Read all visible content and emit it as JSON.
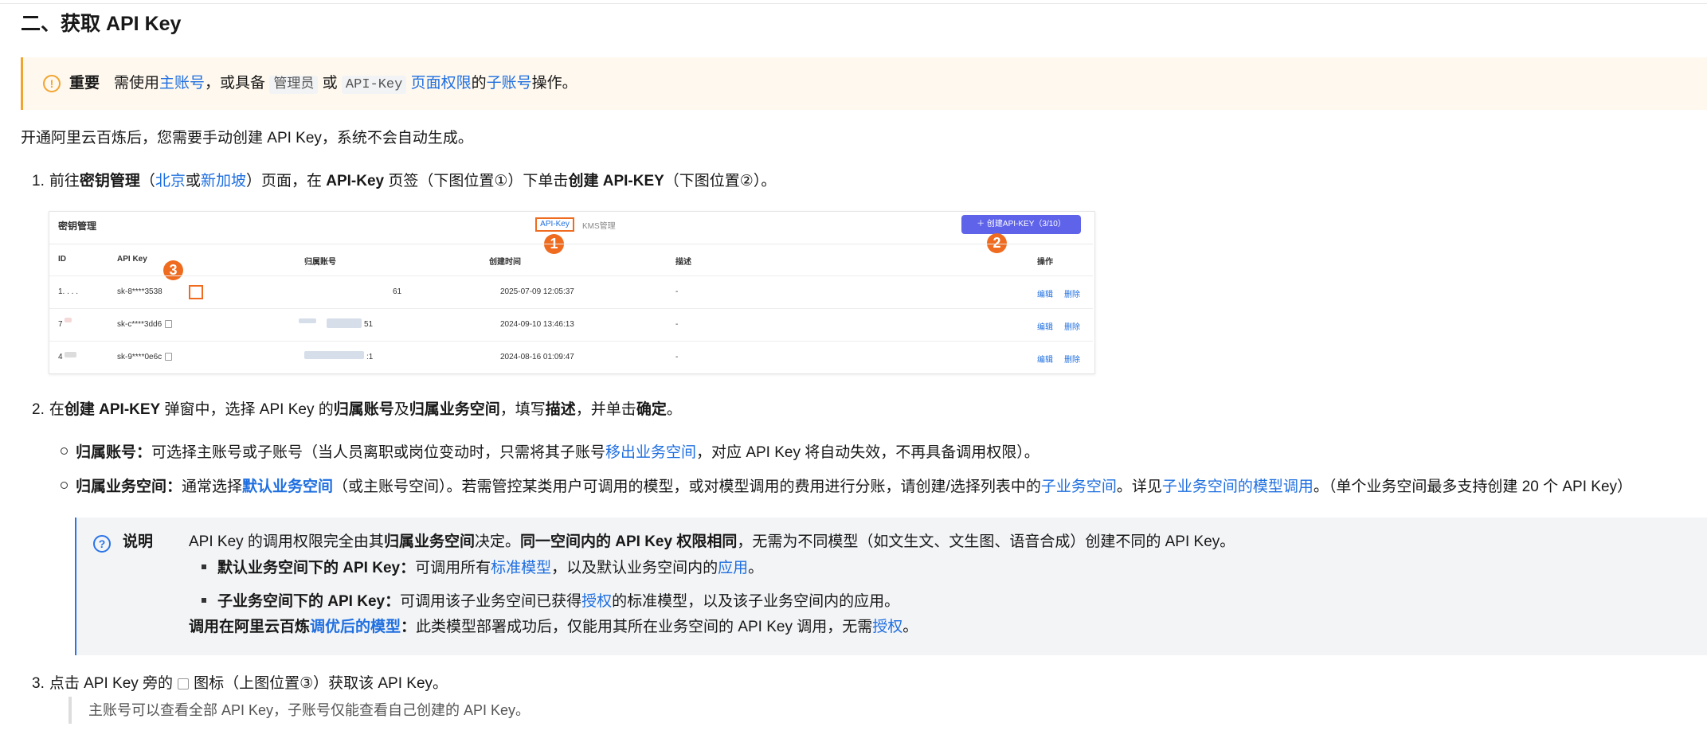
{
  "section_title": "二、获取 API Key",
  "notice": {
    "label": "重要",
    "t1": "需使用",
    "link1": "主账号",
    "t2": "，或具备",
    "code1": "管理员",
    "t3": "或",
    "code2": "API-Key",
    "link2": "页面权限",
    "t4": "的",
    "link3": "子账号",
    "t5": "操作。"
  },
  "intro": "开通阿里云百炼后，您需要手动创建 API Key，系统不会自动生成。",
  "step1": {
    "num": "1.",
    "t1": "前往",
    "b1": "密钥管理",
    "t2": "（",
    "link1": "北京",
    "t3": "或",
    "link2": "新加坡",
    "t4": "）页面，在",
    "b2": "API-Key",
    "t5": "页签（下图位置①）下单击",
    "b3": "创建 API-KEY",
    "t6": "（下图位置②）。"
  },
  "screenshot": {
    "title": "密钥管理",
    "tab_active": "API-Key",
    "tab_other": "KMS管理",
    "create_button": "＋ 创建API-KEY（3/10）",
    "badge1": "1",
    "badge2": "2",
    "badge3": "3",
    "headers": [
      "ID",
      "API Key",
      "归属账号",
      "创建时间",
      "描述",
      "操作"
    ],
    "rows": [
      {
        "id": "1. . . .",
        "key": "sk-8****3538",
        "account": "61",
        "created": "2025-07-09 12:05:37",
        "desc": "-",
        "edit": "编辑",
        "del": "删除"
      },
      {
        "id": "7",
        "key": "sk-c****3dd6",
        "account": "51",
        "created": "2024-09-10 13:46:13",
        "desc": "-",
        "edit": "编辑",
        "del": "删除"
      },
      {
        "id": "4",
        "key": "sk-9****0e6c",
        "account": ":1",
        "created": "2024-08-16 01:09:47",
        "desc": "-",
        "edit": "编辑",
        "del": "删除"
      }
    ]
  },
  "step2": {
    "num": "2.",
    "t1": "在",
    "b1": "创建 API-KEY",
    "t2": "弹窗中，选择 API Key 的",
    "b2": "归属账号",
    "t3": "及",
    "b3": "归属业务空间",
    "t4": "，填写",
    "b4": "描述",
    "t5": "，并单击",
    "b5": "确定",
    "t6": "。"
  },
  "bullet1": {
    "b1": "归属账号：",
    "t1": "可选择主账号或子账号（当人员离职或岗位变动时，只需将其子账号",
    "link1": "移出业务空间",
    "t2": "，对应 API Key 将自动失效，不再具备调用权限）。"
  },
  "bullet2": {
    "b1": "归属业务空间：",
    "t1": "通常选择",
    "link1": "默认业务空间",
    "t2": "（或主账号空间）。若需管控某类用户可调用的模型，或对模型调用的费用进行分账，请创建/选择列表中的",
    "link2": "子业务空间",
    "t3": "。详见",
    "link3": "子业务空间的模型调用",
    "t4": "。（单个业务空间最多支持创建 20 个 API Key）"
  },
  "info": {
    "label": "说明",
    "l1_t1": "API Key 的调用权限完全由其",
    "l1_b1": "归属业务空间",
    "l1_t2": "决定。",
    "l1_b2": "同一空间内的 API Key 权限相同",
    "l1_t3": "，无需为不同模型（如文生文、文生图、语音合成）创建不同的 API Key。",
    "l2_b1": "默认业务空间下的 API Key：",
    "l2_t1": "可调用所有",
    "l2_link1": "标准模型",
    "l2_t2": "，以及默认业务空间内的",
    "l2_link2": "应用",
    "l2_t3": "。",
    "l3_b1": "子业务空间下的 API Key：",
    "l3_t1": "可调用该子业务空间已获得",
    "l3_link1": "授权",
    "l3_t2": "的标准模型，以及该子业务空间内的应用。",
    "l4_b1": "调用在阿里云百炼",
    "l4_link1": "调优后的模型",
    "l4_b2": "：",
    "l4_t1": "此类模型部署成功后，仅能用其所在业务空间的 API Key 调用，无需",
    "l4_link2": "授权",
    "l4_t2": "。"
  },
  "step3": {
    "num": "3.",
    "t1": "点击 API Key 旁的",
    "t2": "图标（上图位置③）获取该 API Key。"
  },
  "quote": "主账号可以查看全部 API Key，子账号仅能查看自己创建的 API Key。"
}
